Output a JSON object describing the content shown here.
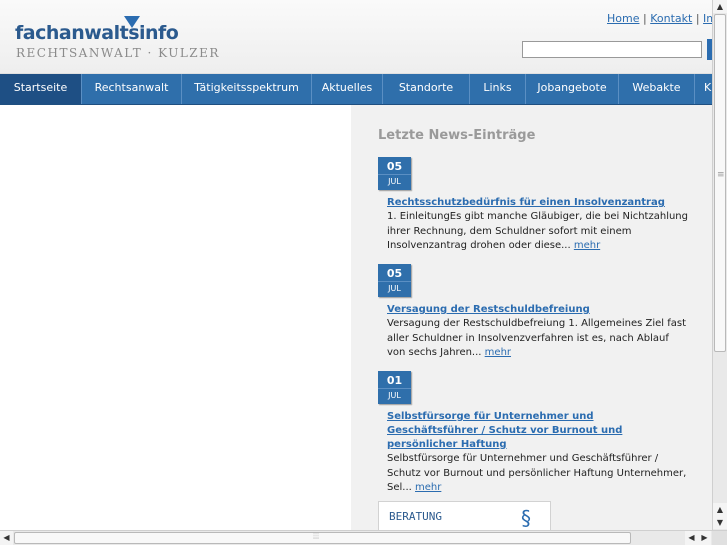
{
  "header": {
    "logo_main": "fachanwaltsinfo",
    "logo_sub": "RECHTSANWALT · KULZER",
    "links": [
      "Home",
      "Kontakt",
      "Im"
    ],
    "separator": "|"
  },
  "nav": {
    "items": [
      "Startseite",
      "Rechtsanwalt",
      "Tätigkeitsspektrum",
      "Aktuelles",
      "Standorte",
      "Links",
      "Jobangebote",
      "Webakte",
      "K"
    ]
  },
  "news": {
    "heading": "Letzte News-Einträge",
    "more_label": "mehr",
    "items": [
      {
        "day": "05",
        "month": "JUL",
        "title": "Rechtsschutzbedürfnis für einen Insolvenzantrag",
        "text": "1. EinleitungEs gibt manche Gläubiger, die bei Nichtzahlung ihrer Rechnung, dem Schuldner sofort mit einem Insolvenzantrag drohen oder diese..."
      },
      {
        "day": "05",
        "month": "JUL",
        "title": "Versagung der Restschuldbefreiung",
        "text": "Versagung der Restschuldbefreiung 1. Allgemeines Ziel fast aller Schuldner in Insolvenzverfahren ist es, nach Ablauf von sechs Jahren..."
      },
      {
        "day": "01",
        "month": "JUL",
        "title": "Selbstfürsorge für Unternehmer und Geschäftsführer / Schutz vor Burnout und persönlicher Haftung",
        "text": "Selbstfürsorge für Unternehmer und Geschäftsführer / Schutz vor Burnout und persönlicher Haftung Unternehmer, Sel..."
      }
    ]
  },
  "box": {
    "label": "BERATUNG",
    "icon": "§"
  },
  "colors": {
    "brand_blue": "#2f6fab",
    "nav_active": "#1e4f84",
    "link": "#2b6cb0"
  }
}
